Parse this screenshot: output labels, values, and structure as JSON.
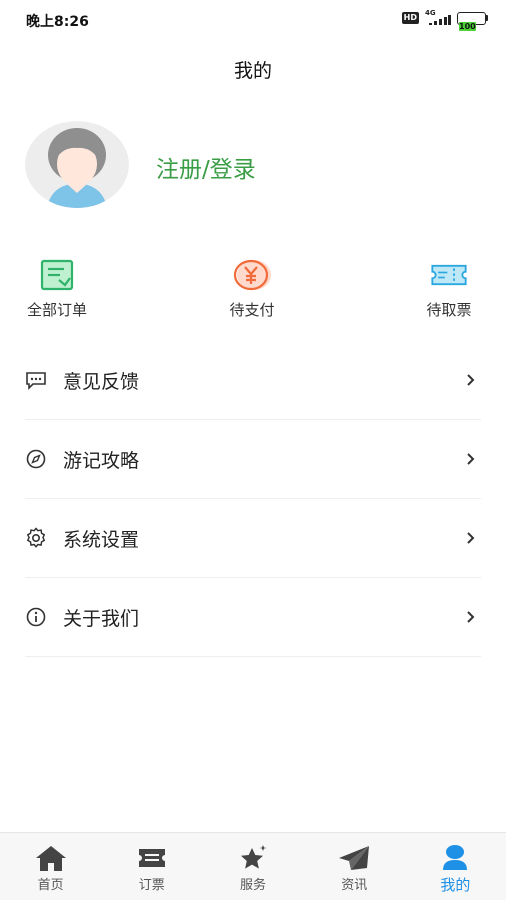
{
  "status_bar": {
    "time": "晚上8:26",
    "hd": "HD",
    "network": "4G",
    "battery": "100"
  },
  "header": {
    "title": "我的"
  },
  "profile": {
    "login_label": "注册/登录"
  },
  "shortcuts": [
    {
      "label": "全部订单",
      "icon": "receipt-icon"
    },
    {
      "label": "待支付",
      "icon": "yen-coin-icon"
    },
    {
      "label": "待取票",
      "icon": "ticket-icon"
    }
  ],
  "menu": [
    {
      "label": "意见反馈",
      "icon": "message-icon"
    },
    {
      "label": "游记攻略",
      "icon": "compass-icon"
    },
    {
      "label": "系统设置",
      "icon": "gear-icon"
    },
    {
      "label": "关于我们",
      "icon": "info-icon"
    }
  ],
  "tabs": [
    {
      "label": "首页",
      "icon": "home-icon"
    },
    {
      "label": "订票",
      "icon": "ticket-tab-icon"
    },
    {
      "label": "服务",
      "icon": "star-icon"
    },
    {
      "label": "资讯",
      "icon": "paper-plane-icon"
    },
    {
      "label": "我的",
      "icon": "user-icon",
      "active": true
    }
  ],
  "colors": {
    "accent_green": "#3a9e46",
    "active_tab": "#1e90e6",
    "pay_orange": "#f06a3a",
    "ticket_blue": "#2aa7e0"
  }
}
